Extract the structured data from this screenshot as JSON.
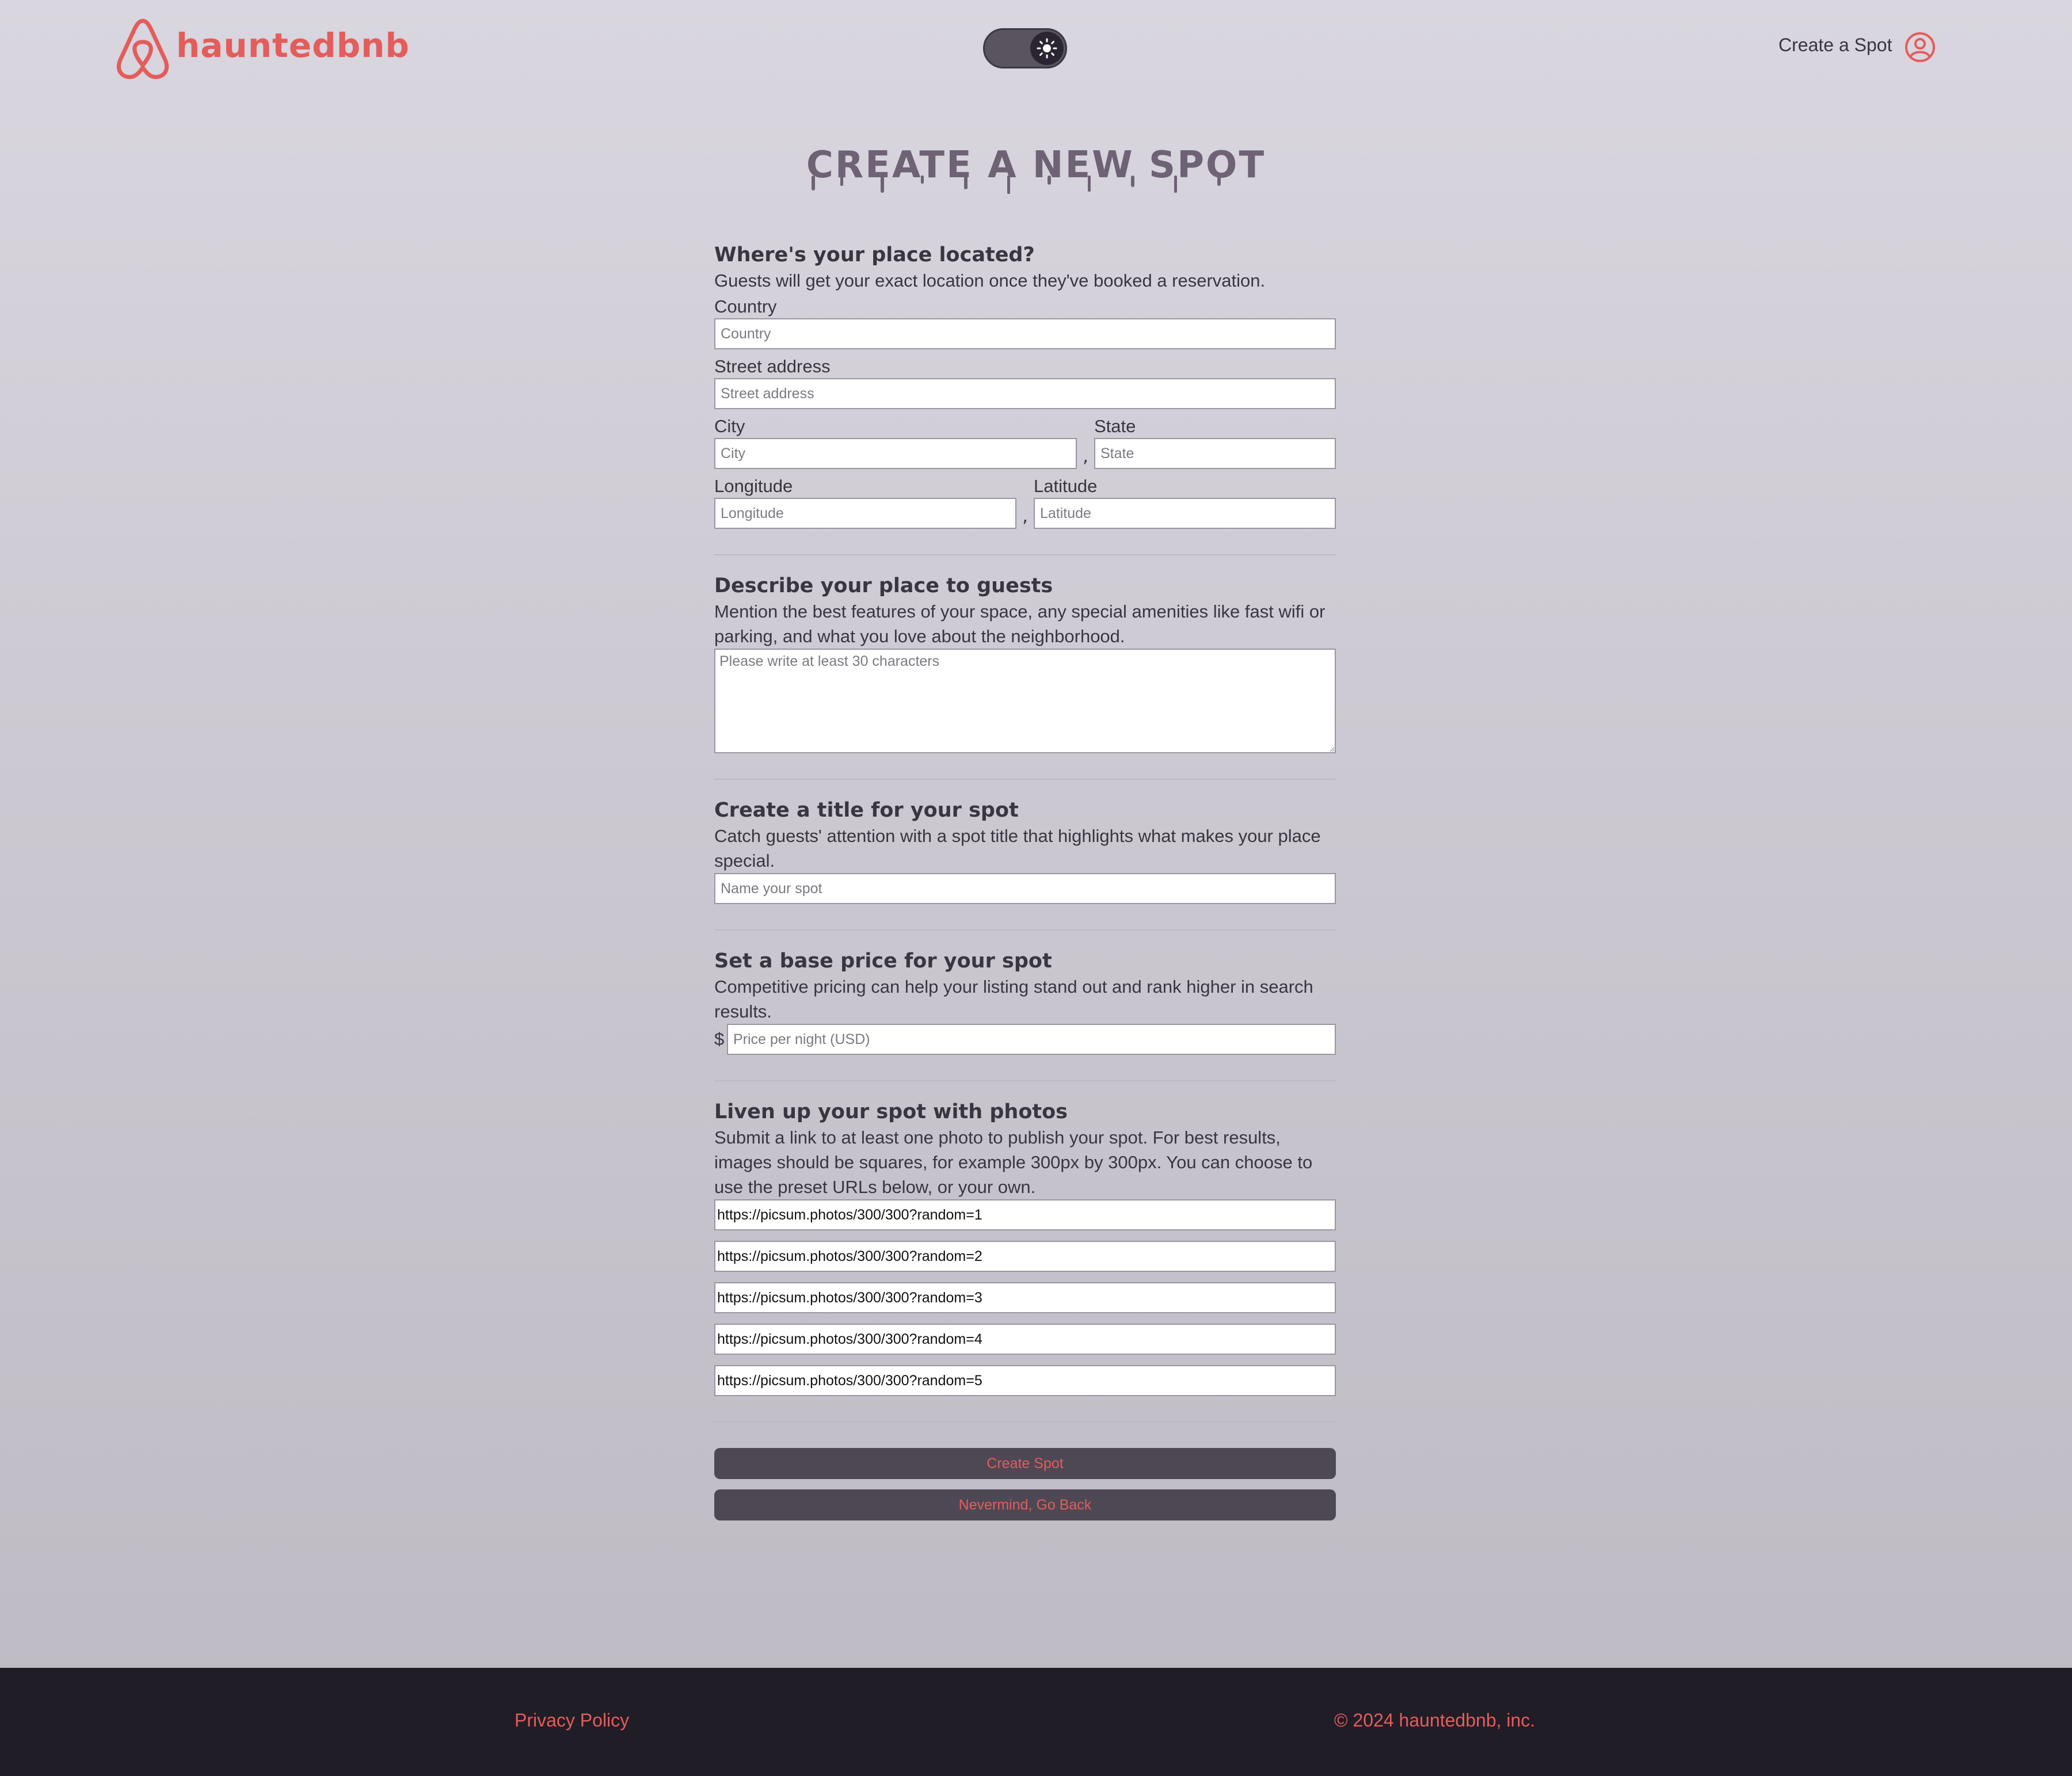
{
  "header": {
    "logo_text": "hauntedbnb",
    "theme_toggle_icon": "sun-icon",
    "create_spot_link": "Create a Spot",
    "user_icon": "user-circle-icon"
  },
  "page_title": "CREATE A NEW SPOT",
  "location": {
    "heading": "Where's your place located?",
    "description": "Guests will get your exact location once they've booked a reservation.",
    "country_label": "Country",
    "country_placeholder": "Country",
    "street_label": "Street address",
    "street_placeholder": "Street address",
    "city_label": "City",
    "city_placeholder": "City",
    "state_label": "State",
    "state_placeholder": "State",
    "longitude_label": "Longitude",
    "longitude_placeholder": "Longitude",
    "latitude_label": "Latitude",
    "latitude_placeholder": "Latitude",
    "separator": ","
  },
  "describe": {
    "heading": "Describe your place to guests",
    "description": "Mention the best features of your space, any special amenities like fast wifi or parking, and what you love about the neighborhood.",
    "placeholder": "Please write at least 30 characters"
  },
  "title_section": {
    "heading": "Create a title for your spot",
    "description": "Catch guests' attention with a spot title that highlights what makes your place special.",
    "placeholder": "Name your spot"
  },
  "price": {
    "heading": "Set a base price for your spot",
    "description": "Competitive pricing can help your listing stand out and rank higher in search results.",
    "currency_symbol": "$",
    "placeholder": "Price per night (USD)"
  },
  "photos": {
    "heading": "Liven up your spot with photos",
    "description": "Submit a link to at least one photo to publish your spot. For best results, images should be squares, for example 300px by 300px. You can choose to use the preset URLs below, or your own.",
    "urls": [
      "https://picsum.photos/300/300?random=1",
      "https://picsum.photos/300/300?random=2",
      "https://picsum.photos/300/300?random=3",
      "https://picsum.photos/300/300?random=4",
      "https://picsum.photos/300/300?random=5"
    ]
  },
  "buttons": {
    "create": "Create Spot",
    "back": "Nevermind, Go Back"
  },
  "footer": {
    "privacy": "Privacy Policy",
    "copyright": "© 2024 hauntedbnb, inc."
  },
  "colors": {
    "accent": "#e35d5b",
    "footer_bg": "#201d27",
    "button_bg": "#4d4854"
  }
}
